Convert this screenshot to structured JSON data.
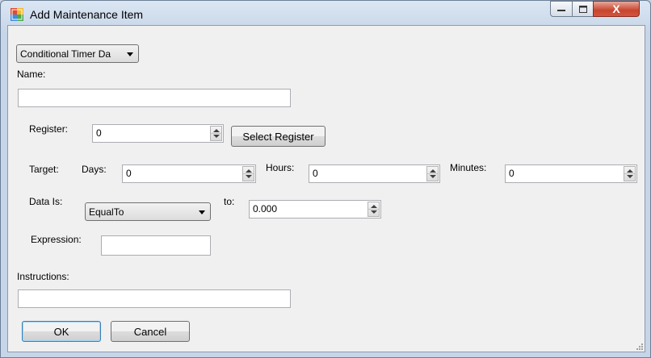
{
  "window": {
    "title": "Add Maintenance Item",
    "close_glyph": "X"
  },
  "type_select": {
    "value": "Conditional Timer Da"
  },
  "name": {
    "label": "Name:",
    "value": ""
  },
  "register": {
    "label": "Register:",
    "value": "0",
    "select_button": "Select Register"
  },
  "target": {
    "label": "Target:",
    "days_label": "Days:",
    "days_value": "0",
    "hours_label": "Hours:",
    "hours_value": "0",
    "minutes_label": "Minutes:",
    "minutes_value": "0"
  },
  "data_is": {
    "label": "Data Is:",
    "value": "EqualTo",
    "to_label": "to:",
    "to_value": "0.000"
  },
  "expression": {
    "label": "Expression:",
    "value": ""
  },
  "instructions": {
    "label": "Instructions:",
    "value": ""
  },
  "buttons": {
    "ok": "OK",
    "cancel": "Cancel"
  },
  "icons": {
    "app": "form-window-icon",
    "minimize": "minimize-icon",
    "maximize": "maximize-icon",
    "close": "close-icon"
  }
}
